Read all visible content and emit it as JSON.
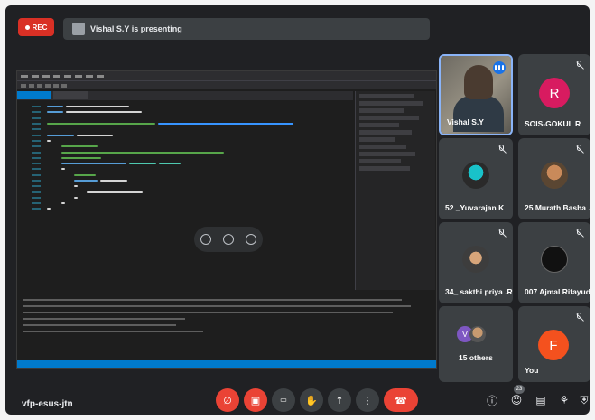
{
  "recording": {
    "label": "REC"
  },
  "presenter_banner": {
    "text": "Vishal S.Y is presenting"
  },
  "participants": [
    {
      "name": "Vishal S.Y",
      "type": "camera",
      "speaking": true
    },
    {
      "name": "SOIS-GOKUL R",
      "type": "initial",
      "initial": "R",
      "color": "#d81b60",
      "muted": true
    },
    {
      "name": "52 _Yuvarajan K",
      "type": "photo",
      "muted": true
    },
    {
      "name": "25 Murath Basha .k",
      "type": "photo",
      "muted": true
    },
    {
      "name": "34_ sakthi priya .R.S",
      "type": "photo",
      "muted": true
    },
    {
      "name": "007 Ajmal Rifayudeen",
      "type": "photo",
      "muted": true
    },
    {
      "name": "15 others",
      "type": "group",
      "initial": "V",
      "color": "#7e57c2"
    },
    {
      "name": "You",
      "type": "initial",
      "initial": "F",
      "color": "#f4511e",
      "muted": true
    }
  ],
  "meeting": {
    "code": "vfp-esus-jtn",
    "participant_count": "23"
  },
  "controls": {
    "mic": "mic-off-icon",
    "camera": "camera-off-icon",
    "captions": "captions-icon",
    "raise_hand": "raise-hand-icon",
    "present": "present-icon",
    "more": "more-options-icon",
    "leave": "end-call-icon"
  },
  "colors": {
    "accent": "#1a73e8",
    "danger": "#ea4335",
    "background": "#202124",
    "tile": "#3c4043"
  }
}
